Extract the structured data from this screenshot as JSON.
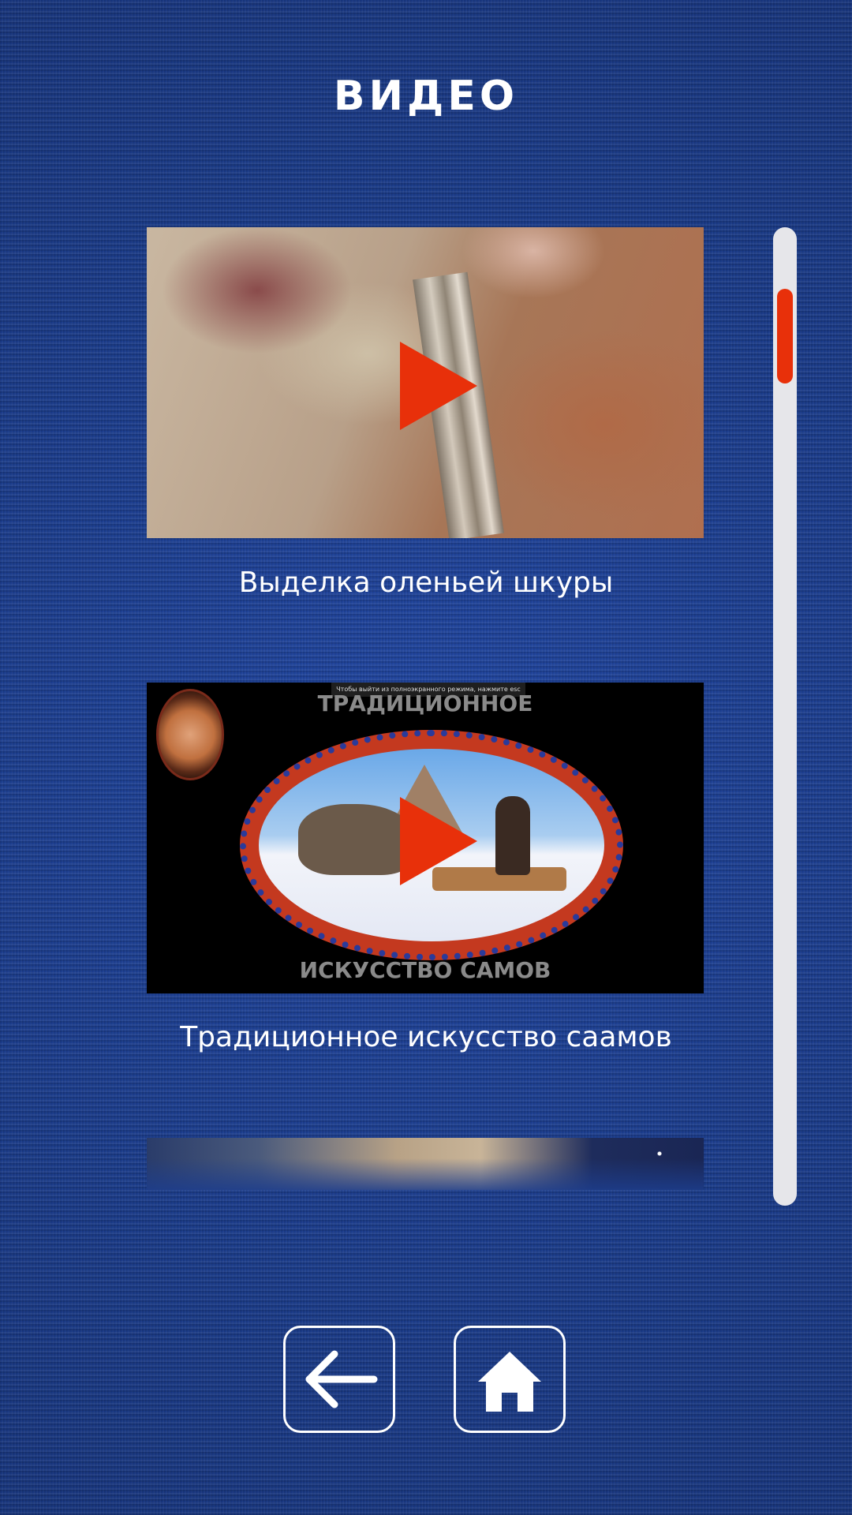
{
  "header": {
    "title": "ВИДЕО"
  },
  "videos": [
    {
      "caption": "Выделка оленьей шкуры"
    },
    {
      "caption": "Традиционное искусство саамов",
      "thumb_top_text": "ТРАДИЦИОННОЕ",
      "thumb_bottom_text": "ИСКУССТВО САМОВ",
      "fullscreen_notice": "Чтобы выйти из полноэкранного режима, нажмите esc"
    },
    {
      "caption": ""
    }
  ],
  "scroll": {
    "position_fraction": 0.07
  },
  "nav": {
    "back_icon": "arrow-left-icon",
    "home_icon": "home-icon"
  },
  "colors": {
    "accent": "#e8300a",
    "background": "#1d3d8c",
    "text": "#ffffff"
  }
}
